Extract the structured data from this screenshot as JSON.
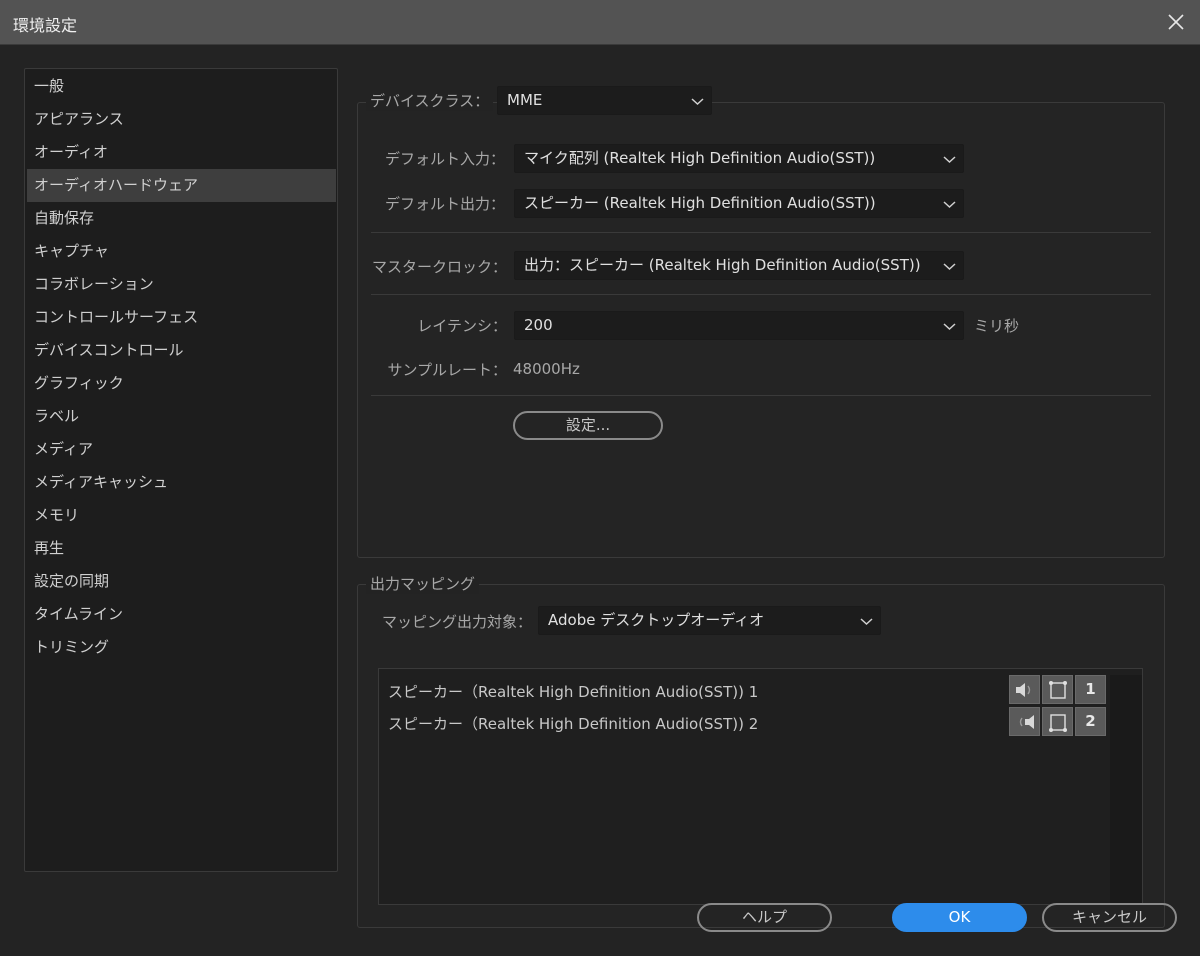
{
  "window": {
    "title": "環境設定"
  },
  "sidebar": {
    "items": [
      {
        "label": "一般"
      },
      {
        "label": "アピアランス"
      },
      {
        "label": "オーディオ"
      },
      {
        "label": "オーディオハードウェア",
        "selected": true
      },
      {
        "label": "自動保存"
      },
      {
        "label": "キャプチャ"
      },
      {
        "label": "コラボレーション"
      },
      {
        "label": "コントロールサーフェス"
      },
      {
        "label": "デバイスコントロール"
      },
      {
        "label": "グラフィック"
      },
      {
        "label": "ラベル"
      },
      {
        "label": "メディア"
      },
      {
        "label": "メディアキャッシュ"
      },
      {
        "label": "メモリ"
      },
      {
        "label": "再生"
      },
      {
        "label": "設定の同期"
      },
      {
        "label": "タイムライン"
      },
      {
        "label": "トリミング"
      }
    ]
  },
  "device": {
    "class_label": "デバイスクラス：",
    "class_value": "MME",
    "default_input_label": "デフォルト入力：",
    "default_input_value": "マイク配列 (Realtek High Definition Audio(SST))",
    "default_output_label": "デフォルト出力：",
    "default_output_value": "スピーカー (Realtek High Definition Audio(SST))",
    "master_clock_label": "マスタークロック：",
    "master_clock_value": "出力：スピーカー (Realtek High Definition Audio(SST))",
    "latency_label": "レイテンシ：",
    "latency_value": "200",
    "latency_unit": "ミリ秒",
    "sample_rate_label": "サンプルレート：",
    "sample_rate_value": "48000Hz",
    "settings_button": "設定..."
  },
  "output_mapping": {
    "group_label": "出力マッピング",
    "target_label": "マッピング出力対象：",
    "target_value": "Adobe デスクトップオーディオ",
    "channels": [
      {
        "name": "スピーカー（Realtek High Definition Audio(SST)) 1",
        "number": "1"
      },
      {
        "name": "スピーカー（Realtek High Definition Audio(SST)) 2",
        "number": "2"
      }
    ]
  },
  "footer": {
    "help": "ヘルプ",
    "ok": "OK",
    "cancel": "キャンセル"
  }
}
